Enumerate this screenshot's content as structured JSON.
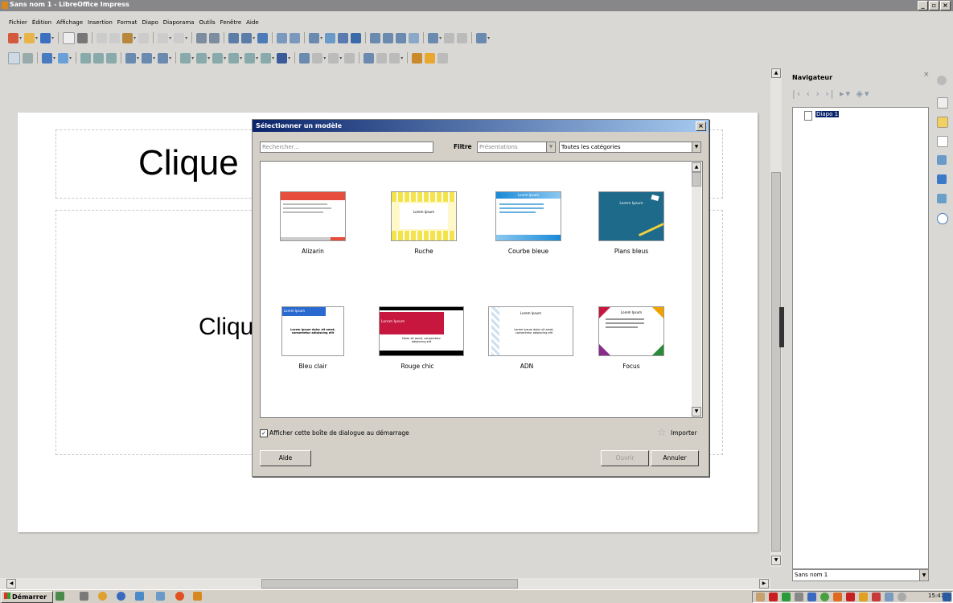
{
  "window": {
    "title": "Sans nom 1 - LibreOffice Impress",
    "minimize": "_",
    "restore": "▫",
    "close": "×"
  },
  "menu": [
    "Fichier",
    "Édition",
    "Affichage",
    "Insertion",
    "Format",
    "Diapo",
    "Diaporama",
    "Outils",
    "Fenêtre",
    "Aide"
  ],
  "slide": {
    "title_placeholder": "Clique",
    "body_placeholder": "Cliqu"
  },
  "navigator": {
    "title": "Navigateur",
    "close": "×",
    "item": "Diapo 1",
    "document": "Sans nom 1"
  },
  "dialog": {
    "title": "Sélectionner un modèle",
    "close": "×",
    "search_placeholder": "Rechercher...",
    "filter_label": "Filtre",
    "filter_value": "Présentations",
    "category_value": "Toutes les catégories",
    "templates": [
      {
        "name": "Alizarin"
      },
      {
        "name": "Ruche"
      },
      {
        "name": "Courbe bleue"
      },
      {
        "name": "Plans bleus"
      },
      {
        "name": "Bleu clair"
      },
      {
        "name": "Rouge chic"
      },
      {
        "name": "ADN"
      },
      {
        "name": "Focus"
      }
    ],
    "thumbs": {
      "lorem": "Lorem Ipsum",
      "lorem_body": "Lorem ipsum dolor sit amet, consectetur adipiscing elit",
      "dolor": "Dolor sit amet, consectetur adipiscing elit"
    },
    "show_at_startup": "Afficher cette boîte de dialogue au démarrage",
    "import": "Importer",
    "help": "Aide",
    "open": "Ouvrir",
    "cancel": "Annuler"
  },
  "taskbar": {
    "start": "Démarrer",
    "clock": "15:41"
  },
  "colors": {
    "accent": "#0a246a",
    "selection": "#0a246a",
    "alizarin": "#e74c3c",
    "rouge": "#c8173f",
    "focus_orange": "#f0a300"
  }
}
